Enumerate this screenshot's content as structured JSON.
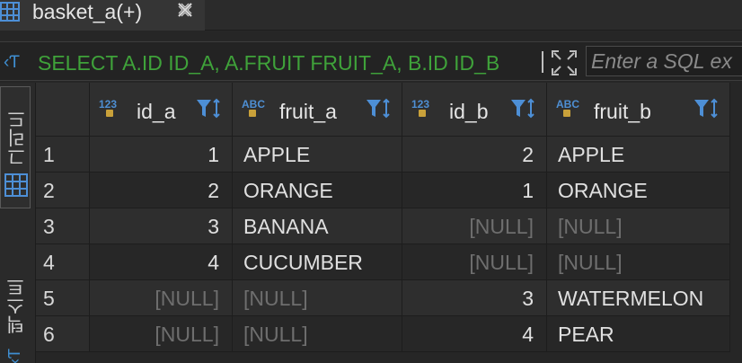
{
  "tab": {
    "title": "basket_a(+)"
  },
  "sqlbar": {
    "query": "SELECT A.ID ID_A, A.FRUIT FRUIT_A, B.ID ID_B",
    "filter_placeholder": "Enter a SQL ex"
  },
  "sidepanel": {
    "grid_label": "그리드",
    "text_label": "텍스트"
  },
  "columns": [
    {
      "name": "id_a",
      "type": "123",
      "align": "num"
    },
    {
      "name": "fruit_a",
      "type": "ABC",
      "align": "txt"
    },
    {
      "name": "id_b",
      "type": "123",
      "align": "num"
    },
    {
      "name": "fruit_b",
      "type": "ABC",
      "align": "txt"
    }
  ],
  "rows": [
    {
      "num": "1",
      "cells": [
        "1",
        "APPLE",
        "2",
        "APPLE"
      ]
    },
    {
      "num": "2",
      "cells": [
        "2",
        "ORANGE",
        "1",
        "ORANGE"
      ]
    },
    {
      "num": "3",
      "cells": [
        "3",
        "BANANA",
        "[NULL]",
        "[NULL]"
      ]
    },
    {
      "num": "4",
      "cells": [
        "4",
        "CUCUMBER",
        "[NULL]",
        "[NULL]"
      ]
    },
    {
      "num": "5",
      "cells": [
        "[NULL]",
        "[NULL]",
        "3",
        "WATERMELON"
      ]
    },
    {
      "num": "6",
      "cells": [
        "[NULL]",
        "[NULL]",
        "4",
        "PEAR"
      ]
    }
  ],
  "colors": {
    "sql_text": "#3fa23a",
    "accent_blue": "#3f8fd2",
    "null_text": "#6e6e6e"
  }
}
